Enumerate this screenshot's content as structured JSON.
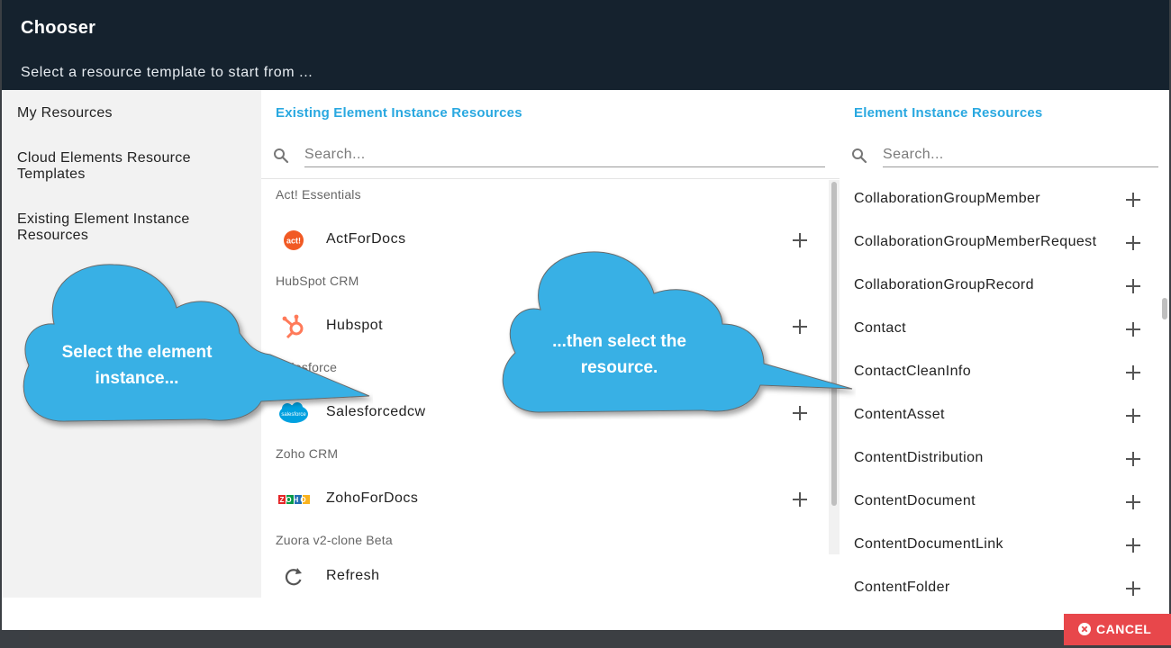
{
  "dialog": {
    "title": "Chooser",
    "subtitle": "Select a resource template to start from ..."
  },
  "sidebar": {
    "items": [
      {
        "label": "My Resources"
      },
      {
        "label": "Cloud Elements Resource Templates"
      },
      {
        "label": "Existing Element Instance Resources"
      }
    ]
  },
  "instances_panel": {
    "title": "Existing Element Instance Resources",
    "search_placeholder": "Search...",
    "groups": [
      {
        "label": "Act! Essentials",
        "item": "ActForDocs",
        "icon": "act-logo-icon"
      },
      {
        "label": "HubSpot CRM",
        "item": "Hubspot",
        "icon": "hubspot-logo-icon"
      },
      {
        "label": "Salesforce",
        "item": "Salesforcedcw",
        "icon": "salesforce-logo-icon"
      },
      {
        "label": "Zoho CRM",
        "item": "ZohoForDocs",
        "icon": "zoho-logo-icon"
      },
      {
        "label": "Zuora v2-clone Beta",
        "item": "Refresh",
        "icon": "refresh-icon"
      }
    ],
    "logo_texts": {
      "act": "act!",
      "salesforce": "salesforce",
      "zoho": "ZOHO"
    }
  },
  "resources_panel": {
    "title": "Element Instance Resources",
    "search_placeholder": "Search...",
    "items": [
      "CollaborationGroupMember",
      "CollaborationGroupMemberRequest",
      "CollaborationGroupRecord",
      "Contact",
      "ContactCleanInfo",
      "ContentAsset",
      "ContentDistribution",
      "ContentDocument",
      "ContentDocumentLink",
      "ContentFolder"
    ]
  },
  "footer": {
    "cancel_label": "CANCEL"
  },
  "callouts": {
    "left": {
      "line1": "Select the element",
      "line2": "instance..."
    },
    "right": {
      "line1": "...then select the",
      "line2": "resource."
    }
  },
  "colors": {
    "header": "#15222e",
    "accent": "#29a8e0",
    "callout": "#39b0e5",
    "cancel": "#e8474b"
  }
}
